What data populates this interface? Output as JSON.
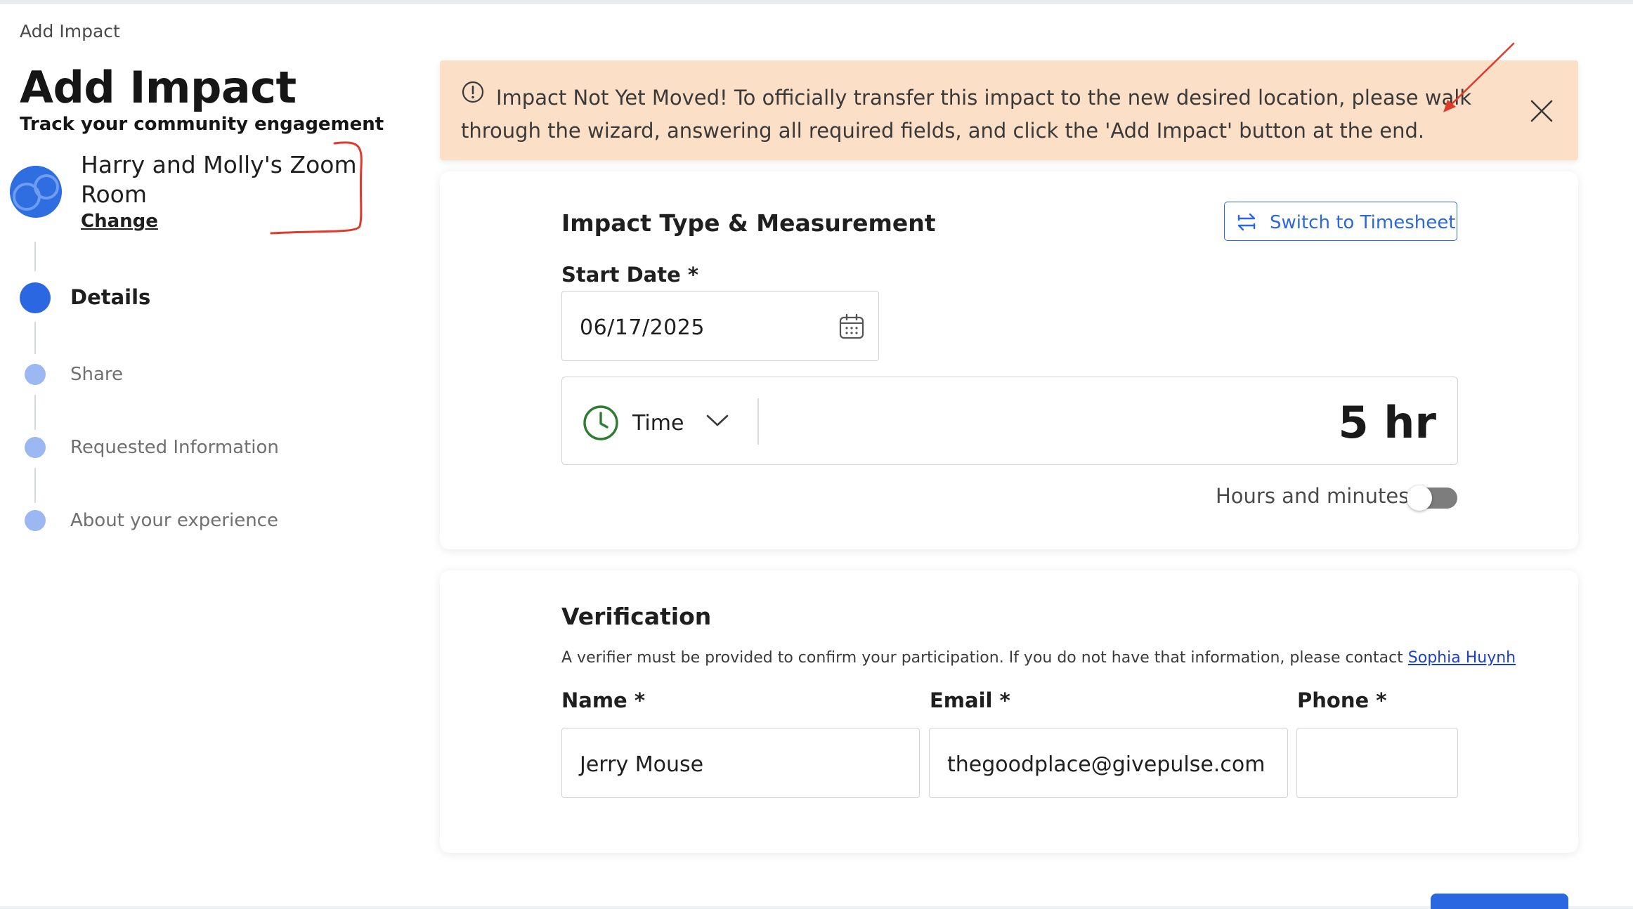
{
  "breadcrumb": "Add Impact",
  "header": {
    "title": "Add Impact",
    "subtitle": "Track your community engagement"
  },
  "organization": {
    "name": "Harry and Molly's Zoom Room",
    "change_link": "Change"
  },
  "steps": [
    {
      "label": "Details",
      "state": "active"
    },
    {
      "label": "Share",
      "state": "upcoming"
    },
    {
      "label": "Requested Information",
      "state": "upcoming"
    },
    {
      "label": "About your experience",
      "state": "upcoming"
    }
  ],
  "alert": {
    "message": "Impact Not Yet Moved! To officially transfer this impact to the new desired location, please walk through the wizard, answering all required fields, and click the 'Add Impact' button at the end.",
    "icon": "exclamation-circle-icon",
    "close_icon": "close-icon"
  },
  "impact_section": {
    "title": "Impact Type & Measurement",
    "switch_button": "Switch to Timesheet",
    "start_date_label": "Start Date *",
    "start_date_value": "06/17/2025",
    "measurement_type": "Time",
    "measurement_value": "5 hr",
    "hours_minutes_label": "Hours and minutes",
    "hours_minutes_enabled": false
  },
  "verification_section": {
    "title": "Verification",
    "note": "A verifier must be provided to confirm your participation. If you do not have that information, please contact",
    "contact_name": "Sophia Huynh",
    "name_label": "Name *",
    "name_value": "Jerry Mouse",
    "email_label": "Email *",
    "email_value": "thegoodplace@givepulse.com",
    "phone_label": "Phone *",
    "phone_value": ""
  },
  "colors": {
    "accent": "#2b67e0",
    "alert_bg": "#fbdfc7",
    "annotation_red": "#e03a2a",
    "time_icon_green": "#2e7d32"
  }
}
